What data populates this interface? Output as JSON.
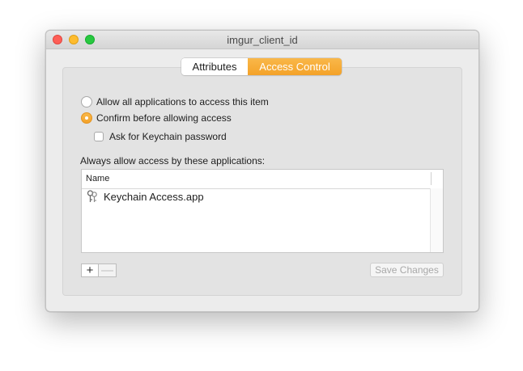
{
  "window": {
    "title": "imgur_client_id"
  },
  "tabs": [
    {
      "label": "Attributes",
      "selected": false
    },
    {
      "label": "Access Control",
      "selected": true
    }
  ],
  "access": {
    "option_allow_all": "Allow all applications to access this item",
    "option_allow_all_selected": false,
    "option_confirm": "Confirm before allowing access",
    "option_confirm_selected": true,
    "ask_password": "Ask for Keychain password",
    "ask_password_checked": false,
    "list_caption": "Always allow access by these applications:"
  },
  "table": {
    "columns": [
      "Name"
    ],
    "rows": [
      {
        "name": "Keychain Access.app",
        "icon": "keychain-access-icon"
      }
    ]
  },
  "buttons": {
    "add": "+",
    "remove": "—",
    "save": "Save Changes",
    "save_enabled": false
  },
  "colors": {
    "accent": "#f5a623",
    "close": "#fe5f57",
    "minimize": "#febc2e",
    "zoom": "#28c840"
  }
}
